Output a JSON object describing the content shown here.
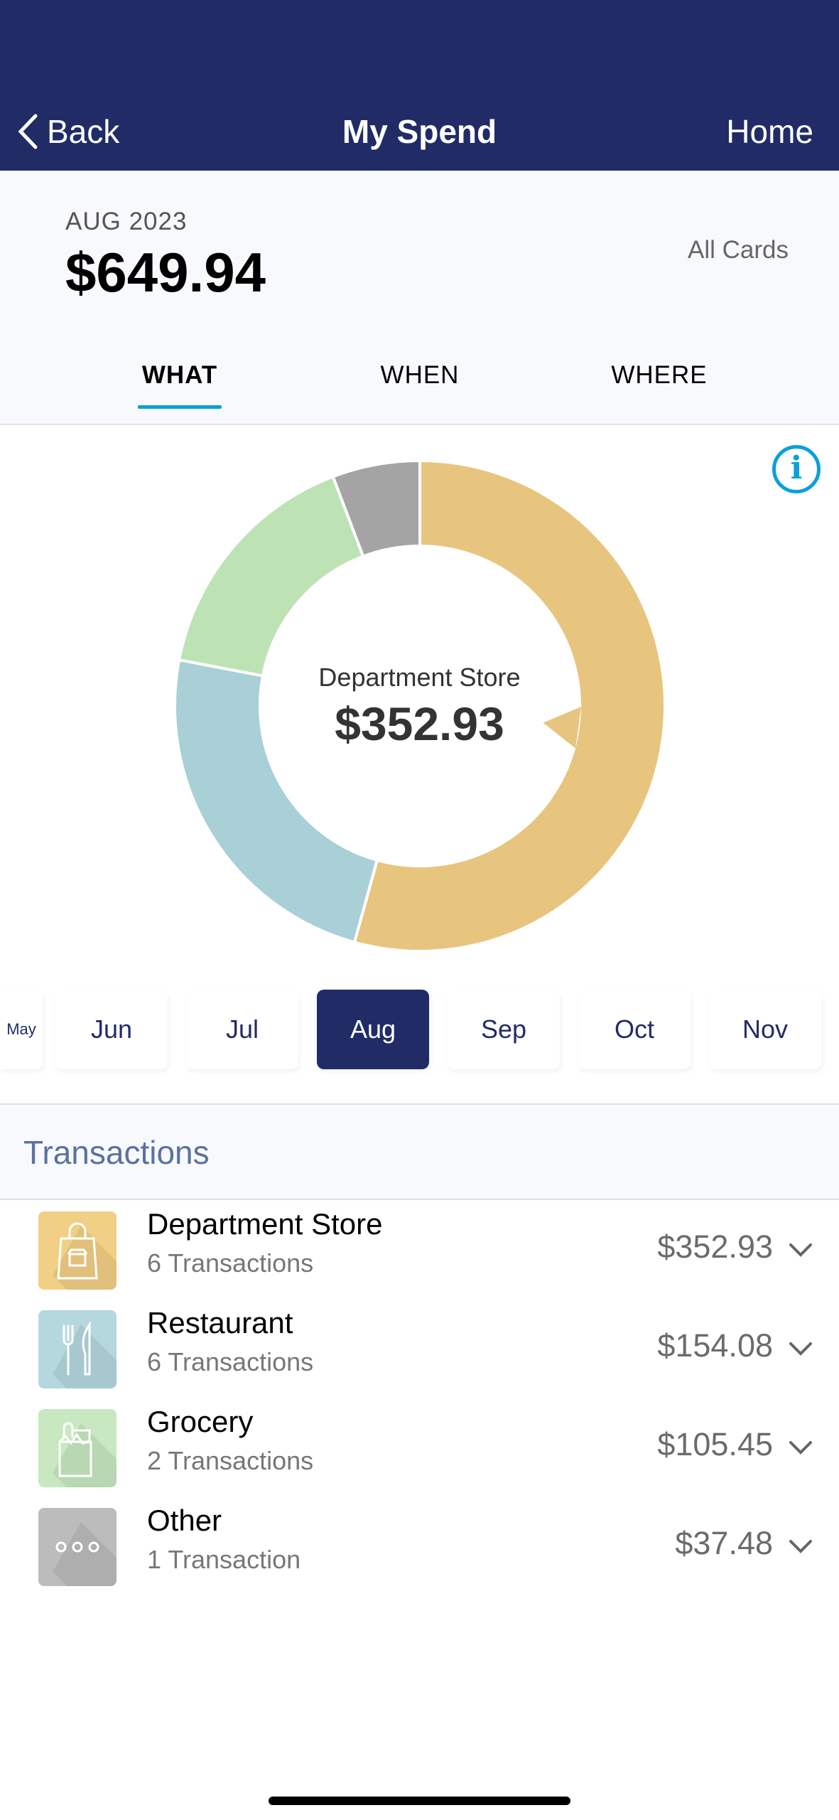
{
  "nav": {
    "back_label": "Back",
    "title": "My Spend",
    "home_label": "Home"
  },
  "summary": {
    "period": "AUG 2023",
    "total": "$649.94",
    "card_filter": "All Cards"
  },
  "tabs": [
    {
      "label": "WHAT",
      "active": true
    },
    {
      "label": "WHEN",
      "active": false
    },
    {
      "label": "WHERE",
      "active": false
    }
  ],
  "chart_data": {
    "type": "pie",
    "variant": "donut",
    "categories": [
      "Department Store",
      "Restaurant",
      "Grocery",
      "Other"
    ],
    "values": [
      352.93,
      154.08,
      105.45,
      37.48
    ],
    "colors": [
      "#e8c57e",
      "#a9d0d6",
      "#bde3b5",
      "#a4a4a4"
    ],
    "selected": "Department Store",
    "center_label": "Department Store",
    "center_value": "$352.93"
  },
  "months": [
    {
      "label": "May",
      "selected": false
    },
    {
      "label": "Jun",
      "selected": false
    },
    {
      "label": "Jul",
      "selected": false
    },
    {
      "label": "Aug",
      "selected": true
    },
    {
      "label": "Sep",
      "selected": false
    },
    {
      "label": "Oct",
      "selected": false
    },
    {
      "label": "Nov",
      "selected": false
    }
  ],
  "transactions": {
    "title": "Transactions",
    "items": [
      {
        "name": "Department Store",
        "count": "6 Transactions",
        "amount": "$352.93",
        "icon": "shopping-bag-icon",
        "color": "#f1cf85"
      },
      {
        "name": "Restaurant",
        "count": "6 Transactions",
        "amount": "$154.08",
        "icon": "fork-knife-icon",
        "color": "#b4d8de"
      },
      {
        "name": "Grocery",
        "count": "2 Transactions",
        "amount": "$105.45",
        "icon": "grocery-bag-icon",
        "color": "#c7e8c0"
      },
      {
        "name": "Other",
        "count": "1 Transaction",
        "amount": "$37.48",
        "icon": "more-dots-icon",
        "color": "#bcbcbc"
      }
    ]
  }
}
